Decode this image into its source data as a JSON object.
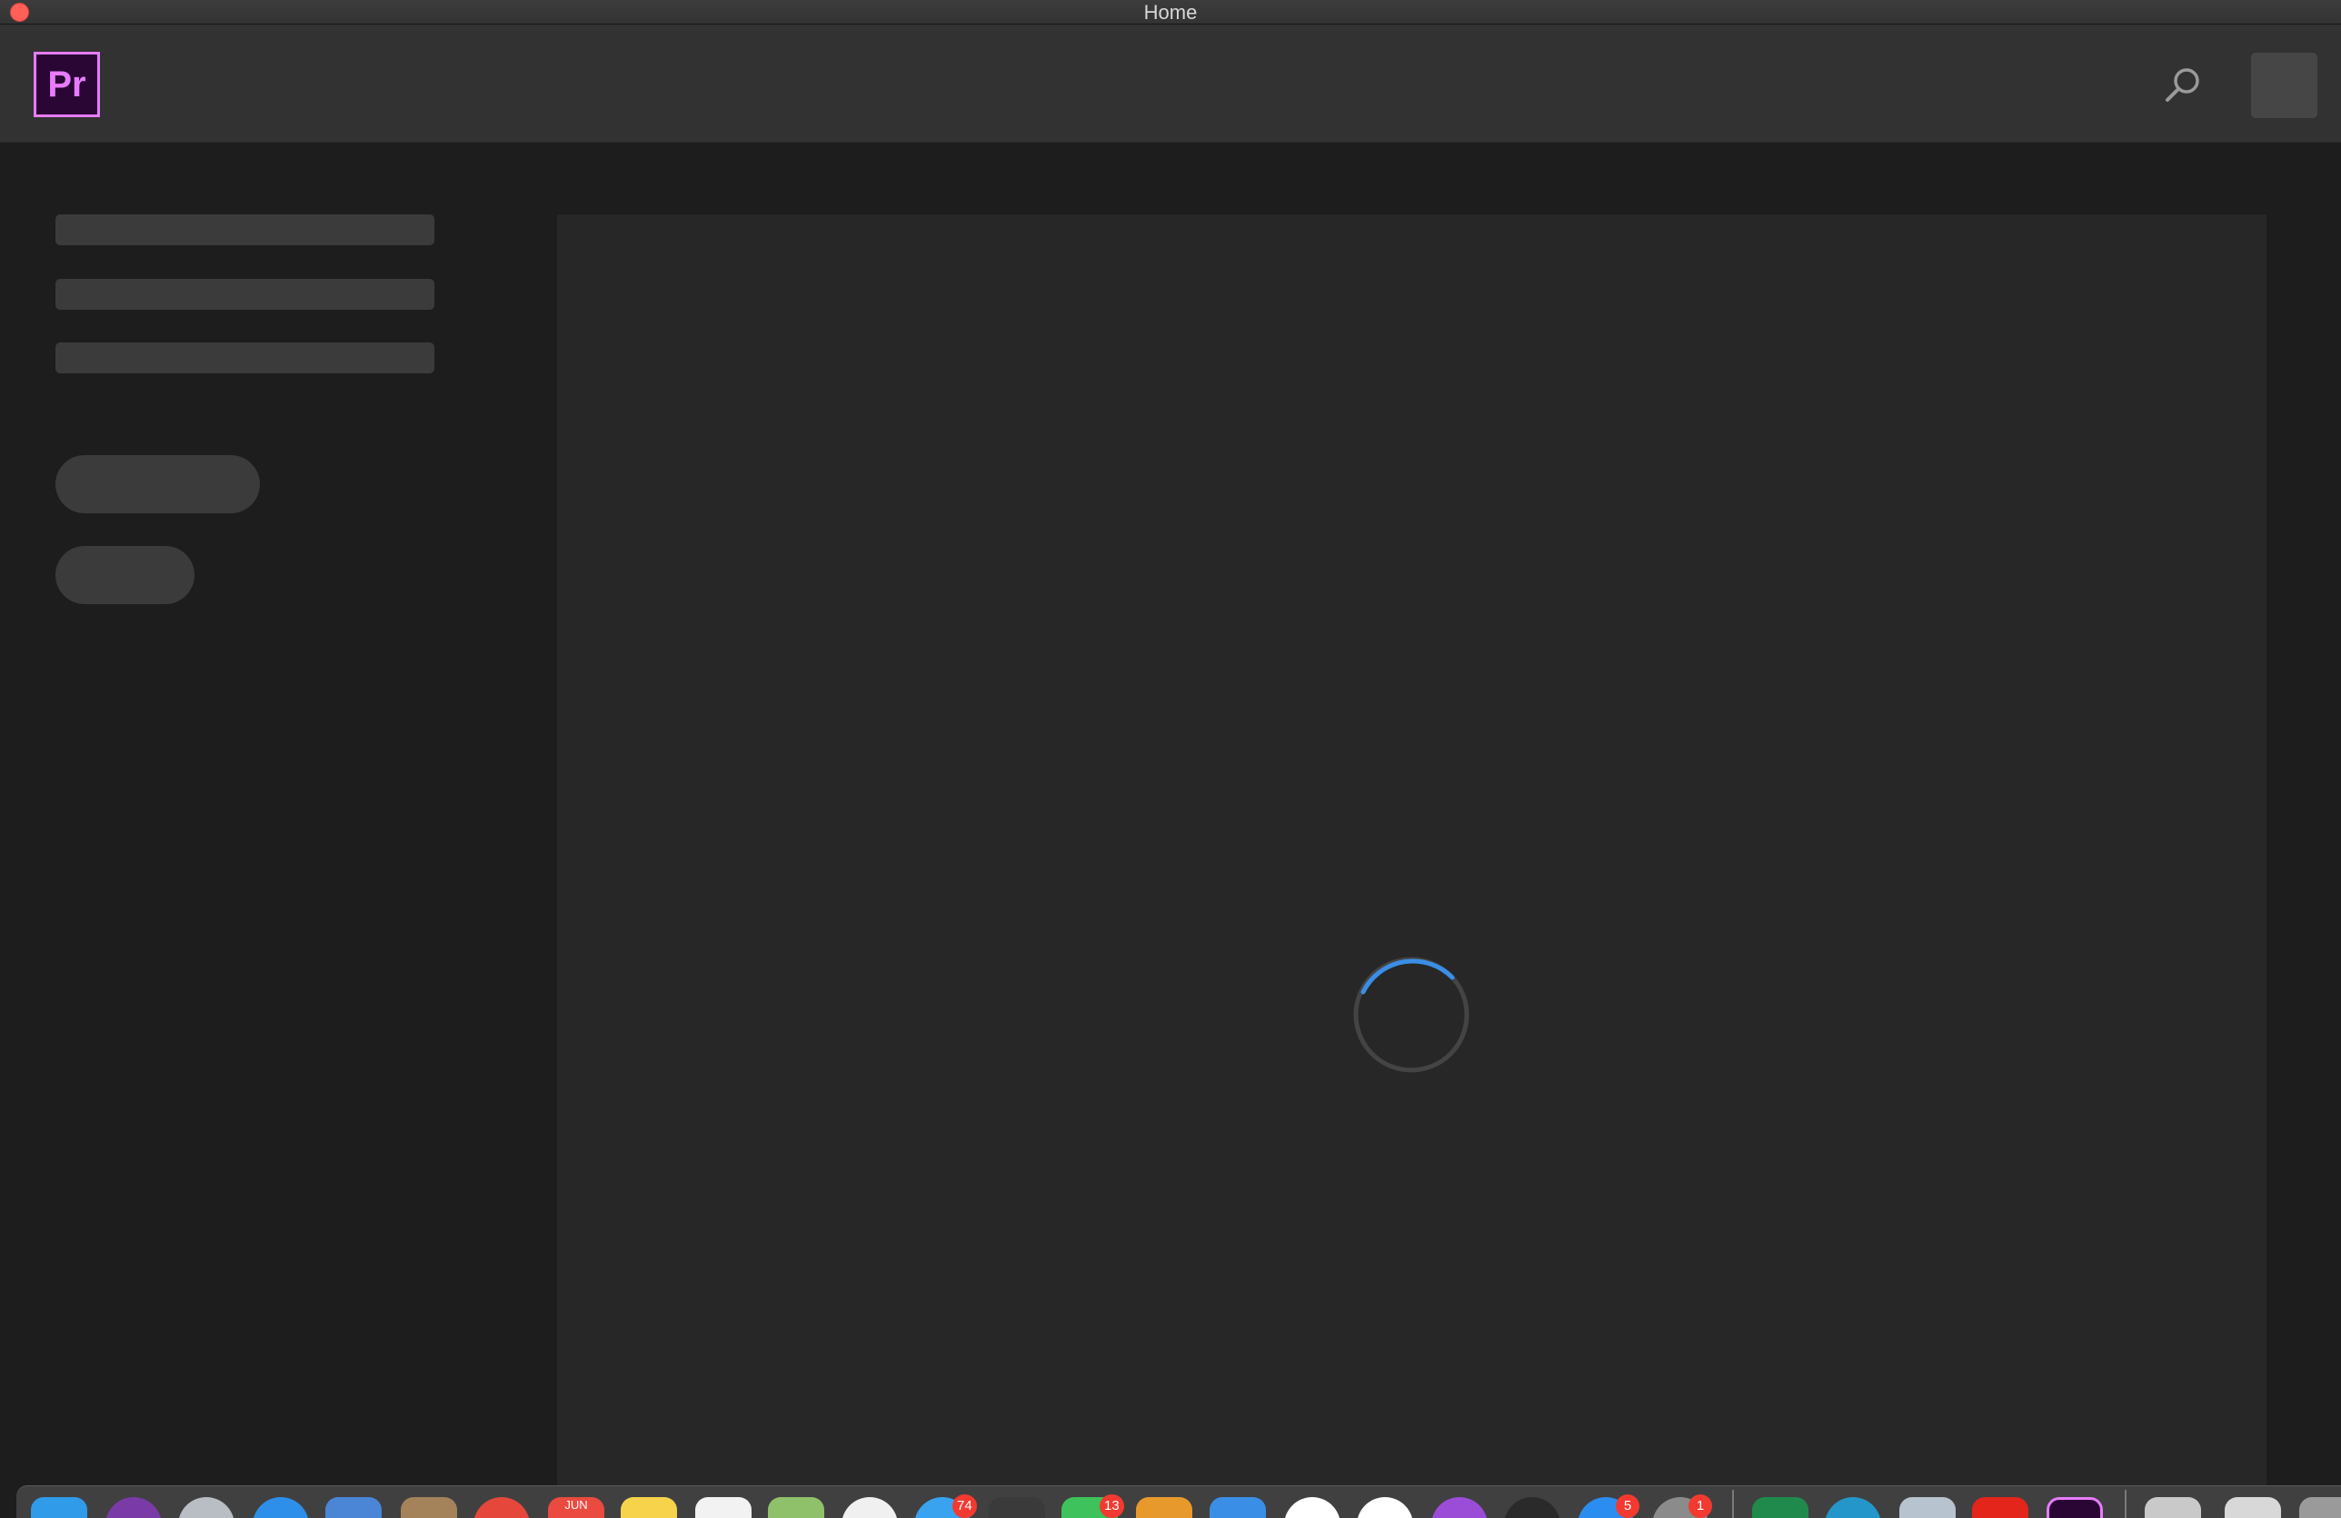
{
  "window": {
    "title": "Home"
  },
  "header": {
    "logo_text": "Pr",
    "logo_color": "#e77cff",
    "search_icon": "search-icon"
  },
  "spinner": {
    "accent": "#3a8ee6"
  },
  "dock": {
    "badges": {
      "mail": "74",
      "messages": "13",
      "app_x": "5",
      "settings": "1"
    },
    "calendar_month": "JUN"
  }
}
